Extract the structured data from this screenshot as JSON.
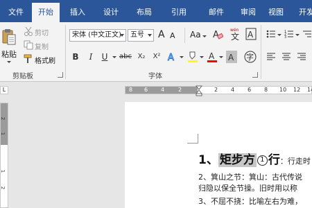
{
  "tabs": [
    "文件",
    "开始",
    "插入",
    "设计",
    "布局",
    "引用",
    "邮件",
    "审阅",
    "视图",
    "开发"
  ],
  "active_tab": "开始",
  "clipboard": {
    "paste_label": "粘贴",
    "cut_label": "剪切",
    "copy_label": "复制",
    "format_painter_label": "格式刷",
    "group_label": "剪贴板"
  },
  "font": {
    "font_name": "宋体 (中文正文)",
    "font_size": "五号",
    "group_label": "字体",
    "grow_label": "A",
    "shrink_label": "A",
    "case_label": "Aa",
    "phonetic_label": "wén",
    "bold": "B",
    "italic": "I",
    "underline": "U",
    "strike": "abc",
    "subscript": "X₂",
    "superscript": "X²",
    "highlight_color": "#ffff00",
    "font_color": "#ff0000",
    "char_shading_label": "A",
    "char_border_label": "A"
  },
  "ruler": {
    "h_numbers": [
      "8",
      "6",
      "4",
      "2",
      "2",
      "4",
      "6",
      "8",
      "10",
      "12",
      "14"
    ],
    "v_numbers": [
      "2",
      "1",
      "1",
      "2"
    ],
    "corner": "L"
  },
  "document": {
    "heading_number": "1、",
    "heading_selected": "矩步方",
    "heading_anchor": "1",
    "heading_rest": "行",
    "heading_tail": "：行走时",
    "lines": [
      "2、箕山之节：箕山：古代传说",
      "归隐以保全节操。旧时用以称",
      "3、不屈不挠：比喻左右为难，"
    ]
  },
  "colors": {
    "tab_bar": "#2b579a",
    "ribbon": "#f3f3f3",
    "selection": "#c6c6c6"
  }
}
